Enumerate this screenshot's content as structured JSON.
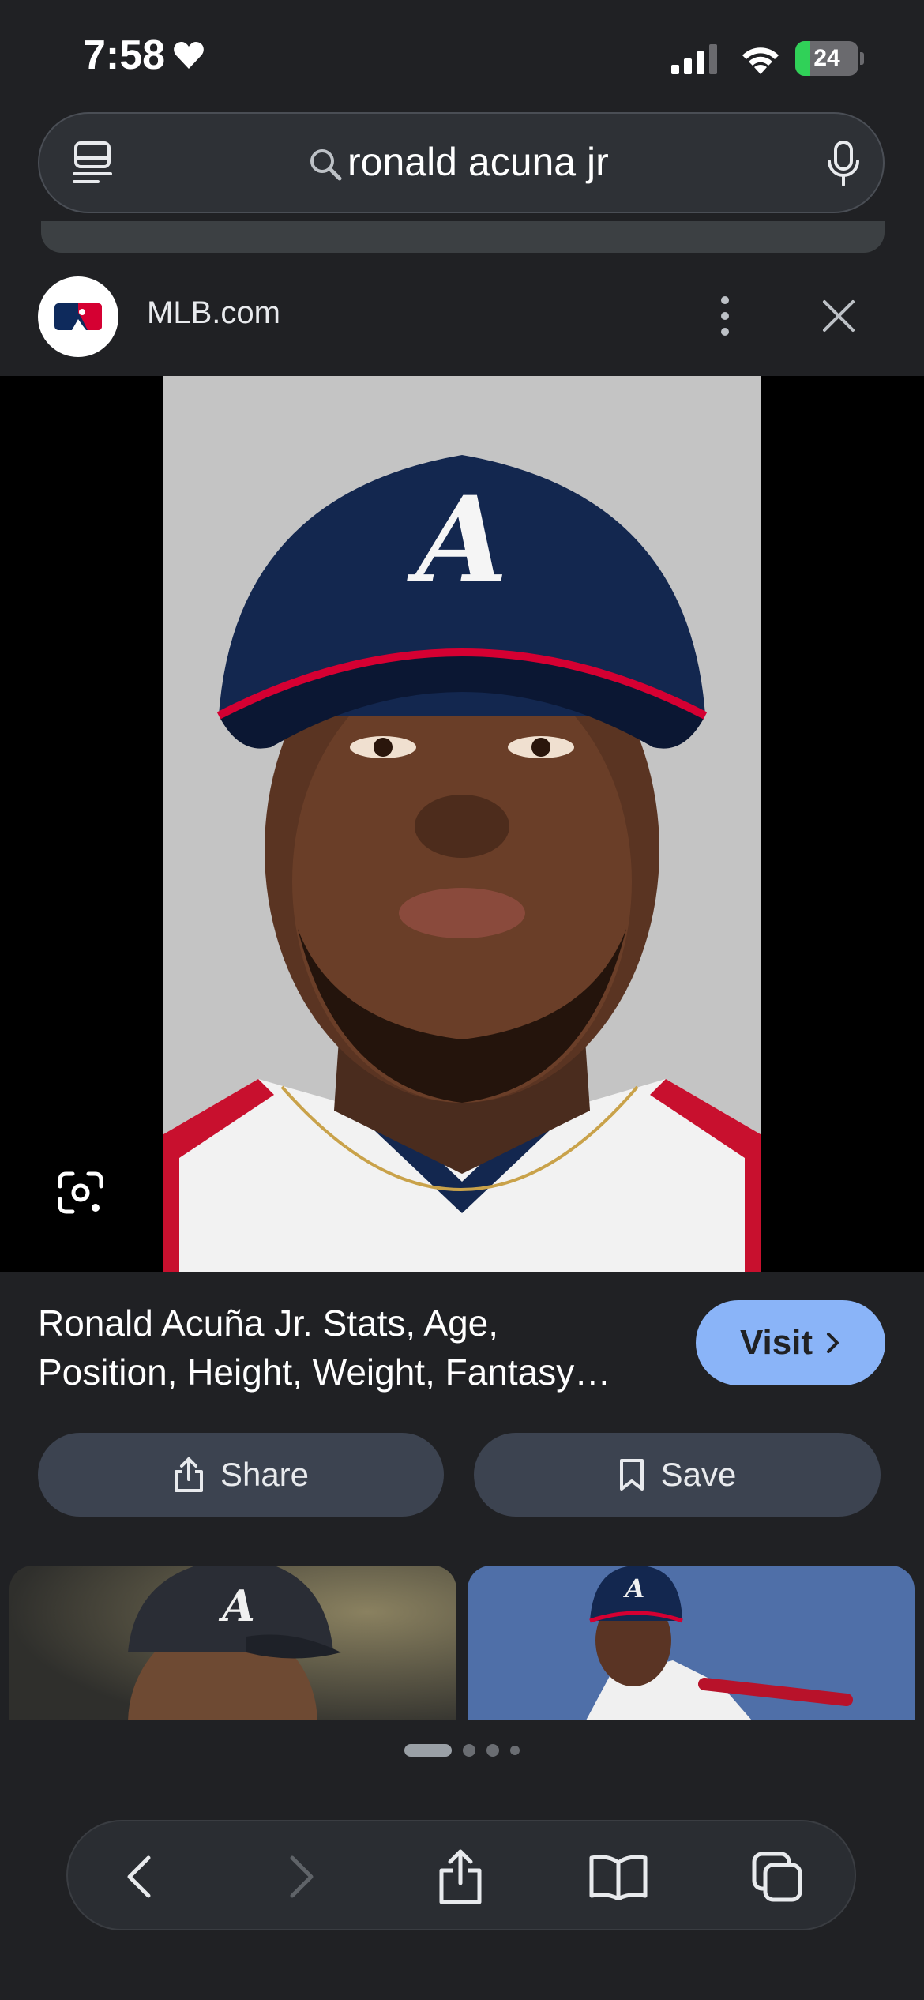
{
  "status_bar": {
    "time": "7:58",
    "battery_percent": "24",
    "battery_level": 0.24,
    "icons": [
      "heart-icon",
      "signal-icon",
      "wifi-icon",
      "battery-charging-icon"
    ]
  },
  "search": {
    "query": "ronald acuna jr",
    "icons": [
      "tabs-icon",
      "search-icon",
      "mic-icon"
    ]
  },
  "source": {
    "name": "MLB.com",
    "logo": "mlb-logo"
  },
  "result": {
    "title_line1": "Ronald Acuña Jr. Stats, Age,",
    "title_line2": "Position, Height, Weight, Fantasy…",
    "visit_label": "Visit",
    "share_label": "Share",
    "save_label": "Save"
  },
  "pager": {
    "total_dots": 4,
    "active_index": 0
  },
  "toolbar": {
    "items": [
      "back-icon",
      "forward-icon",
      "share-icon",
      "bookmarks-icon",
      "tabs-overview-icon"
    ]
  },
  "colors": {
    "background": "#202124",
    "accent": "#8ab4f8",
    "pill": "#3c4350",
    "battery_fill": "#30d158"
  }
}
